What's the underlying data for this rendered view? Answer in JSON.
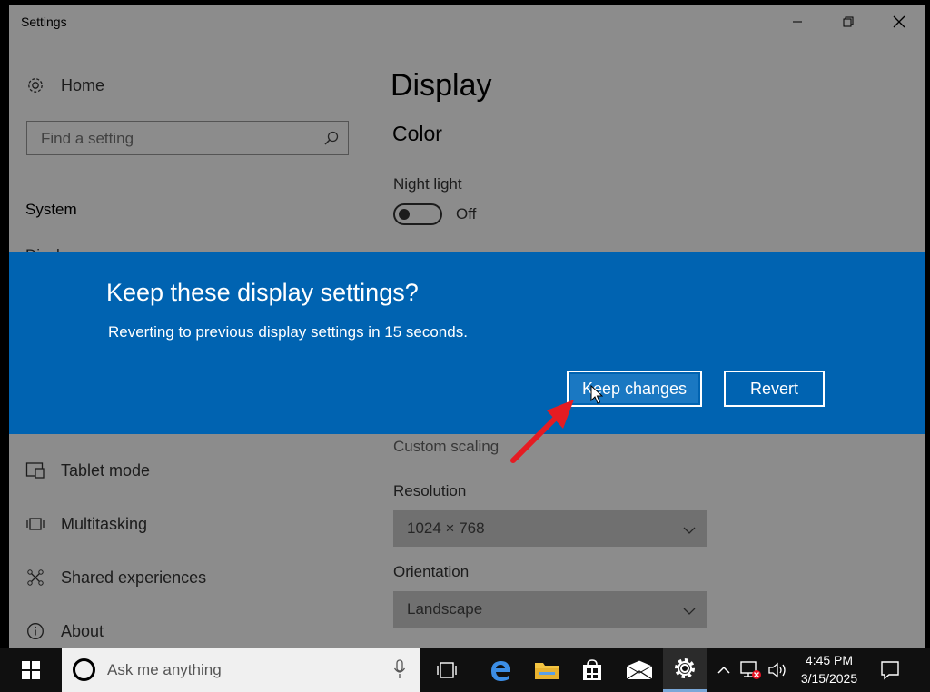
{
  "window": {
    "title": "Settings"
  },
  "sidebar": {
    "home_label": "Home",
    "search_placeholder": "Find a setting",
    "section_label": "System",
    "peek_label": "Display",
    "items": [
      {
        "label": "Tablet mode",
        "icon": "tablet-mode-icon"
      },
      {
        "label": "Multitasking",
        "icon": "multitasking-icon"
      },
      {
        "label": "Shared experiences",
        "icon": "shared-experiences-icon"
      },
      {
        "label": "About",
        "icon": "info-icon"
      }
    ]
  },
  "main": {
    "title": "Display",
    "color_heading": "Color",
    "night_light_label": "Night light",
    "night_light_state": "Off",
    "custom_scaling_label": "Custom scaling",
    "resolution_label": "Resolution",
    "resolution_value": "1024 × 768",
    "orientation_label": "Orientation",
    "orientation_value": "Landscape"
  },
  "dialog": {
    "heading": "Keep these display settings?",
    "message": "Reverting to previous display settings in 15 seconds.",
    "keep_label": "Keep changes",
    "revert_label": "Revert",
    "background_color": "#0063b1"
  },
  "taskbar": {
    "search_placeholder": "Ask me anything",
    "time": "4:45 PM",
    "date": "3/15/2025"
  },
  "colors": {
    "accent": "#0063b1",
    "annotation_arrow": "#e51c23"
  }
}
